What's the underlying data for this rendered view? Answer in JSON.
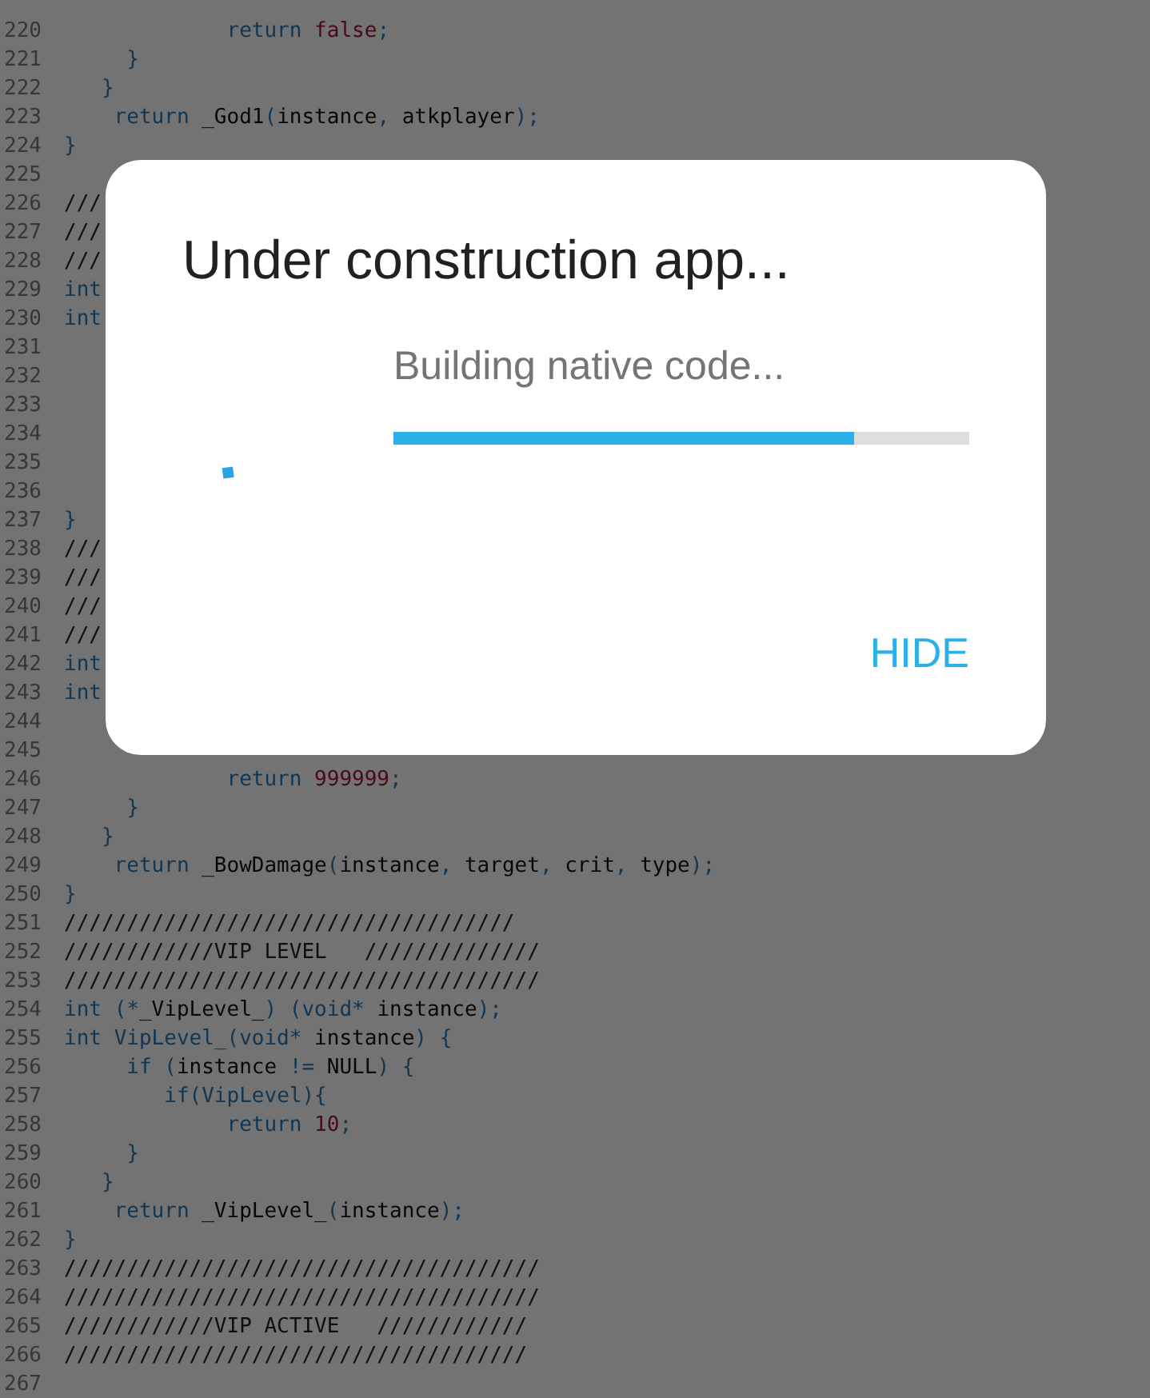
{
  "editor": {
    "lines": [
      {
        "number": "220",
        "segments": [
          {
            "kind": "keyword",
            "text": "             return "
          },
          {
            "kind": "literal",
            "text": "false"
          },
          {
            "kind": "punct",
            "text": ";"
          }
        ]
      },
      {
        "number": "221",
        "segments": [
          {
            "kind": "punct",
            "text": "     }"
          }
        ]
      },
      {
        "number": "222",
        "segments": [
          {
            "kind": "punct",
            "text": "   }"
          }
        ]
      },
      {
        "number": "223",
        "segments": [
          {
            "kind": "keyword",
            "text": "    return "
          },
          {
            "kind": "ident",
            "text": "_God1"
          },
          {
            "kind": "punct",
            "text": "("
          },
          {
            "kind": "ident",
            "text": "instance"
          },
          {
            "kind": "punct",
            "text": ", "
          },
          {
            "kind": "ident",
            "text": "atkplayer"
          },
          {
            "kind": "punct",
            "text": ");"
          }
        ]
      },
      {
        "number": "224",
        "segments": [
          {
            "kind": "punct",
            "text": "}"
          }
        ]
      },
      {
        "number": "225"
      },
      {
        "number": "226",
        "segments": [
          {
            "kind": "comment",
            "text": "///"
          }
        ]
      },
      {
        "number": "227",
        "segments": [
          {
            "kind": "comment",
            "text": "///"
          }
        ]
      },
      {
        "number": "228",
        "segments": [
          {
            "kind": "comment",
            "text": "///"
          }
        ]
      },
      {
        "number": "229",
        "segments": [
          {
            "kind": "keyword",
            "text": "int"
          }
        ]
      },
      {
        "number": "230",
        "segments": [
          {
            "kind": "keyword",
            "text": "int"
          }
        ]
      },
      {
        "number": "231"
      },
      {
        "number": "232"
      },
      {
        "number": "233"
      },
      {
        "number": "234"
      },
      {
        "number": "235"
      },
      {
        "number": "236"
      },
      {
        "number": "237",
        "segments": [
          {
            "kind": "punct",
            "text": "}"
          }
        ]
      },
      {
        "number": "238",
        "segments": [
          {
            "kind": "comment",
            "text": "///"
          }
        ]
      },
      {
        "number": "239",
        "segments": [
          {
            "kind": "comment",
            "text": "///"
          }
        ]
      },
      {
        "number": "240",
        "segments": [
          {
            "kind": "comment",
            "text": "///"
          }
        ]
      },
      {
        "number": "241",
        "segments": [
          {
            "kind": "comment",
            "text": "///"
          }
        ]
      },
      {
        "number": "242",
        "segments": [
          {
            "kind": "keyword",
            "text": "int"
          }
        ]
      },
      {
        "number": "243",
        "segments": [
          {
            "kind": "keyword",
            "text": "int"
          }
        ]
      },
      {
        "number": "244"
      },
      {
        "number": "245"
      },
      {
        "number": "246",
        "segments": [
          {
            "kind": "keyword",
            "text": "             return "
          },
          {
            "kind": "literal",
            "text": "999999"
          },
          {
            "kind": "punct",
            "text": ";"
          }
        ]
      },
      {
        "number": "247",
        "segments": [
          {
            "kind": "punct",
            "text": "     }"
          }
        ]
      },
      {
        "number": "248",
        "segments": [
          {
            "kind": "punct",
            "text": "   }"
          }
        ]
      },
      {
        "number": "249",
        "segments": [
          {
            "kind": "keyword",
            "text": "    return "
          },
          {
            "kind": "ident",
            "text": "_BowDamage"
          },
          {
            "kind": "punct",
            "text": "("
          },
          {
            "kind": "ident",
            "text": "instance"
          },
          {
            "kind": "punct",
            "text": ", "
          },
          {
            "kind": "ident",
            "text": "target"
          },
          {
            "kind": "punct",
            "text": ", "
          },
          {
            "kind": "ident",
            "text": "crit"
          },
          {
            "kind": "punct",
            "text": ", "
          },
          {
            "kind": "ident",
            "text": "type"
          },
          {
            "kind": "punct",
            "text": ");"
          }
        ]
      },
      {
        "number": "250",
        "segments": [
          {
            "kind": "punct",
            "text": "}"
          }
        ]
      },
      {
        "number": "251",
        "segments": [
          {
            "kind": "comment",
            "text": "////////////////////////////////////"
          }
        ]
      },
      {
        "number": "252",
        "segments": [
          {
            "kind": "comment",
            "text": "////////////VIP LEVEL   //////////////"
          }
        ]
      },
      {
        "number": "253",
        "segments": [
          {
            "kind": "comment",
            "text": "//////////////////////////////////////"
          }
        ]
      },
      {
        "number": "254",
        "segments": [
          {
            "kind": "keyword",
            "text": "int "
          },
          {
            "kind": "punct",
            "text": "(*"
          },
          {
            "kind": "ident",
            "text": "_VipLevel_"
          },
          {
            "kind": "punct",
            "text": ") (void* "
          },
          {
            "kind": "ident",
            "text": "instance"
          },
          {
            "kind": "punct",
            "text": ");"
          }
        ]
      },
      {
        "number": "255",
        "segments": [
          {
            "kind": "keyword",
            "text": "int "
          },
          {
            "kind": "punct",
            "text": "VipLevel_(void* "
          },
          {
            "kind": "ident",
            "text": "instance"
          },
          {
            "kind": "punct",
            "text": ") {"
          }
        ]
      },
      {
        "number": "256",
        "segments": [
          {
            "kind": "keyword",
            "text": "     if "
          },
          {
            "kind": "punct",
            "text": "("
          },
          {
            "kind": "ident",
            "text": "instance "
          },
          {
            "kind": "punct",
            "text": "!= "
          },
          {
            "kind": "ident",
            "text": "NULL"
          },
          {
            "kind": "punct",
            "text": ") {"
          }
        ]
      },
      {
        "number": "257",
        "segments": [
          {
            "kind": "keyword",
            "text": "        if"
          },
          {
            "kind": "punct",
            "text": "(VipLevel){"
          }
        ]
      },
      {
        "number": "258",
        "segments": [
          {
            "kind": "keyword",
            "text": "             return "
          },
          {
            "kind": "literal",
            "text": "10"
          },
          {
            "kind": "punct",
            "text": ";"
          }
        ]
      },
      {
        "number": "259",
        "segments": [
          {
            "kind": "punct",
            "text": "     }"
          }
        ]
      },
      {
        "number": "260",
        "segments": [
          {
            "kind": "punct",
            "text": "   }"
          }
        ]
      },
      {
        "number": "261",
        "segments": [
          {
            "kind": "keyword",
            "text": "    return "
          },
          {
            "kind": "ident",
            "text": "_VipLevel_"
          },
          {
            "kind": "punct",
            "text": "("
          },
          {
            "kind": "ident",
            "text": "instance"
          },
          {
            "kind": "punct",
            "text": ");"
          }
        ]
      },
      {
        "number": "262",
        "segments": [
          {
            "kind": "punct",
            "text": "}"
          }
        ]
      },
      {
        "number": "263",
        "segments": [
          {
            "kind": "comment",
            "text": "//////////////////////////////////////"
          }
        ]
      },
      {
        "number": "264",
        "segments": [
          {
            "kind": "comment",
            "text": "//////////////////////////////////////"
          }
        ]
      },
      {
        "number": "265",
        "segments": [
          {
            "kind": "comment",
            "text": "////////////VIP ACTIVE   ////////////"
          }
        ]
      },
      {
        "number": "266",
        "segments": [
          {
            "kind": "comment",
            "text": "/////////////////////////////////////"
          }
        ]
      },
      {
        "number": "267"
      }
    ]
  },
  "dialog": {
    "title": "Under construction app...",
    "message": "Building native code...",
    "progress": {
      "level": 0.8
    },
    "buttons": [
      {
        "label": "HIDE"
      }
    ]
  }
}
